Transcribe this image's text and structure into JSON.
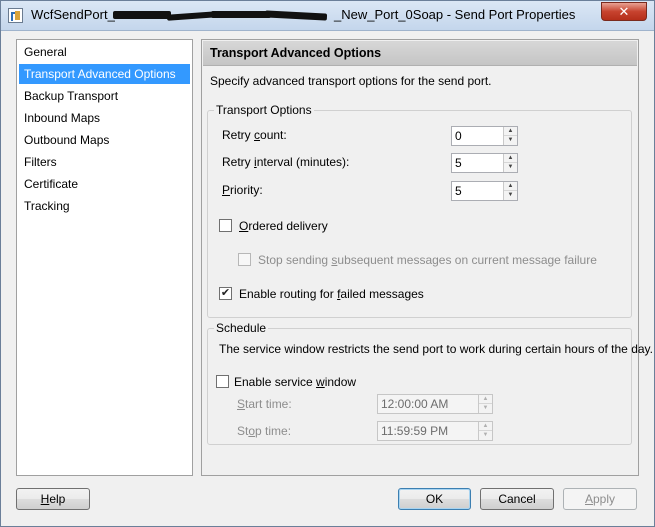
{
  "window": {
    "title_prefix": "WcfSendPort_",
    "title_suffix": "_New_Port_0Soap - Send Port Properties",
    "close_glyph": "✕"
  },
  "nav": {
    "items": [
      {
        "label": "General"
      },
      {
        "label": "Transport Advanced Options",
        "selected": true
      },
      {
        "label": "Backup Transport"
      },
      {
        "label": "Inbound Maps"
      },
      {
        "label": "Outbound Maps"
      },
      {
        "label": "Filters"
      },
      {
        "label": "Certificate"
      },
      {
        "label": "Tracking"
      }
    ]
  },
  "main": {
    "header": "Transport Advanced Options",
    "description": "Specify advanced transport options for the send port.",
    "transport_options": {
      "title": "Transport Options",
      "retry_count": {
        "label_pre": "Retry ",
        "label_key": "c",
        "label_post": "ount:",
        "value": "0"
      },
      "retry_interval": {
        "label_pre": "Retry ",
        "label_key": "i",
        "label_post": "nterval (minutes):",
        "value": "5"
      },
      "priority": {
        "label_pre": "",
        "label_key": "P",
        "label_post": "riority:",
        "value": "5"
      },
      "ordered_delivery": {
        "label_pre": "",
        "label_key": "O",
        "label_post": "rdered delivery",
        "checked": false
      },
      "stop_sending": {
        "label_pre": "Stop sending ",
        "label_key": "s",
        "label_post": "ubsequent messages on current message failure",
        "checked": false,
        "enabled": false
      },
      "enable_routing": {
        "label_pre": "Enable routing for ",
        "label_key": "f",
        "label_post": "ailed messages",
        "checked": true
      }
    },
    "schedule": {
      "title": "Schedule",
      "description": "The service window restricts the send port to work during certain hours of the day.",
      "enable_window": {
        "label_pre": "Enable service ",
        "label_key": "w",
        "label_post": "indow",
        "checked": false
      },
      "start_time": {
        "label_pre": "",
        "label_key": "S",
        "label_post": "tart time:",
        "value": "12:00:00 AM"
      },
      "stop_time": {
        "label_pre": "St",
        "label_key": "o",
        "label_post": "p time:",
        "value": "11:59:59 PM"
      }
    }
  },
  "buttons": {
    "help": {
      "label_key": "H",
      "label_post": "elp"
    },
    "ok": "OK",
    "cancel": "Cancel",
    "apply": {
      "label_key": "A",
      "label_post": "pply",
      "enabled": false
    }
  }
}
